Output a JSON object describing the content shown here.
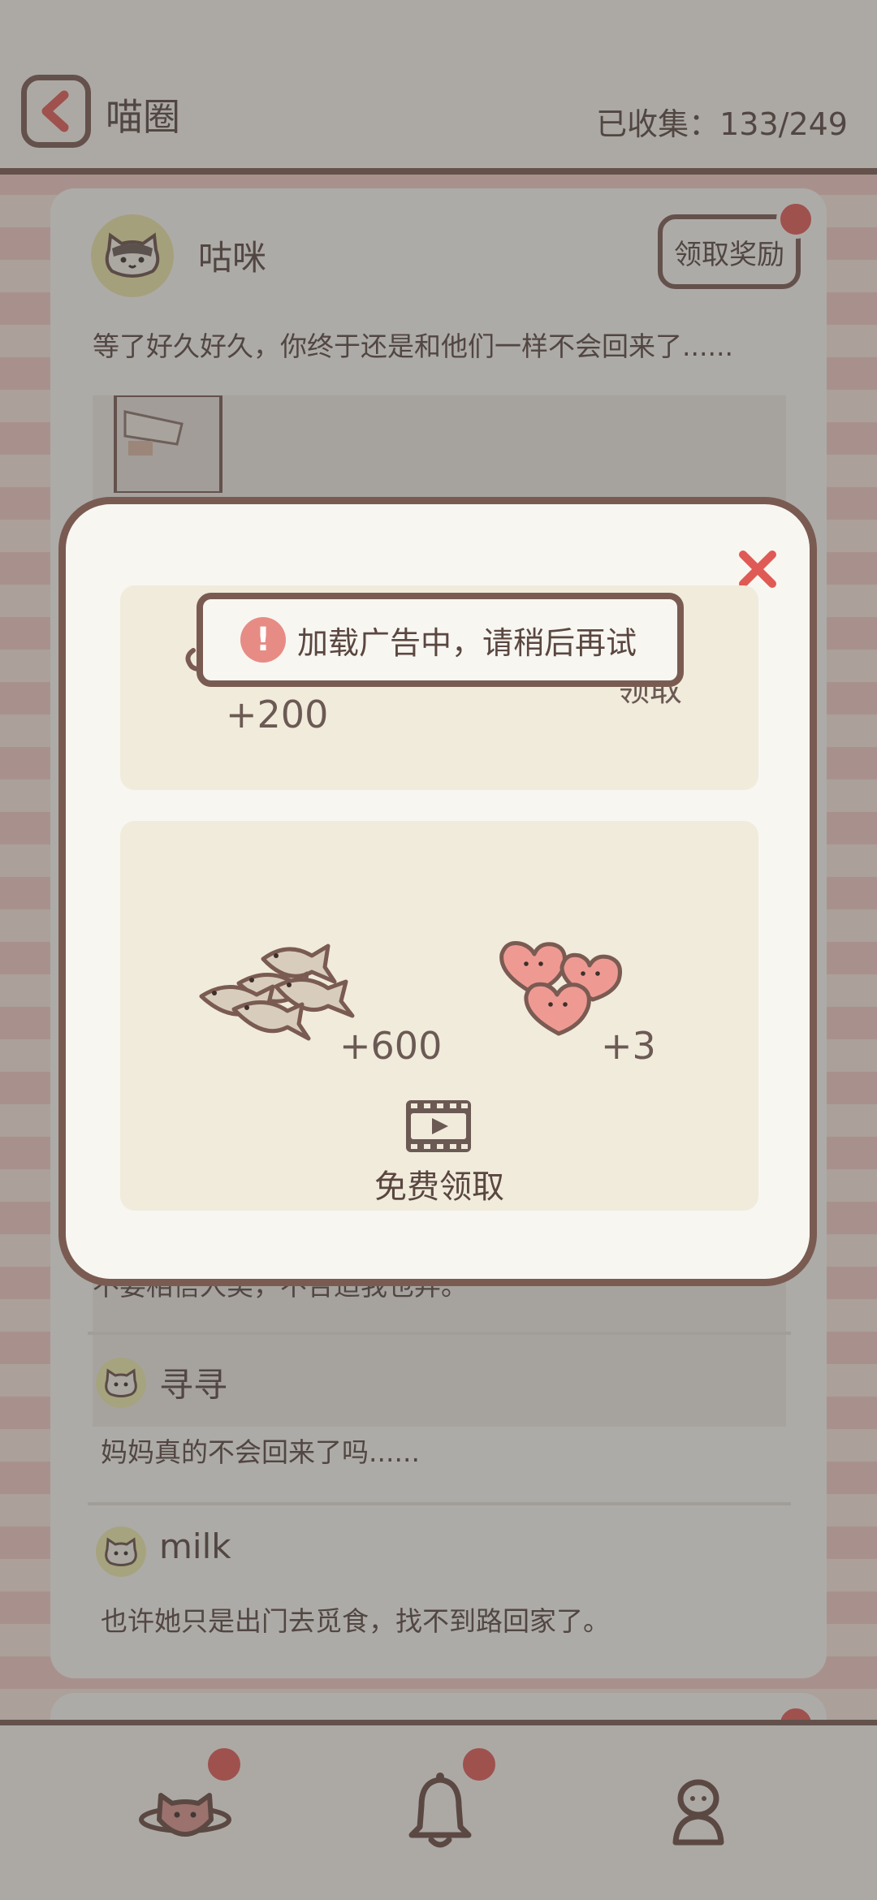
{
  "header": {
    "title": "喵圈",
    "collected_label": "已收集：",
    "collected_value": "133/249"
  },
  "post": {
    "author": "咕咪",
    "reward_button": "领取奖励",
    "text": "等了好久好久，你终于还是和他们一样不会回来了......",
    "partial_comment": "不要相信人类，不合适我也弃。"
  },
  "comments": [
    {
      "name": "寻寻",
      "text": "妈妈真的不会回来了吗......"
    },
    {
      "name": "milk",
      "text": "也许她只是出门去觅食，找不到路回家了。"
    }
  ],
  "modal": {
    "box1": {
      "amount": "+200",
      "partial_label": "领取"
    },
    "box2": {
      "fish_amount": "+600",
      "heart_amount": "+3",
      "claim_label": "免费领取",
      "icons": [
        "fish-bundle-icon",
        "hearts-icon",
        "video-icon"
      ]
    }
  },
  "toast": {
    "message": "加载广告中，请稍后再试",
    "icon": "!"
  },
  "bottom_nav": {
    "items": [
      "planet-cat-icon",
      "bell-icon",
      "profile-icon"
    ]
  },
  "colors": {
    "accent": "#e05a55",
    "outline": "#7a5b52",
    "panel": "#f8f6f1",
    "box": "#f1ebdc"
  }
}
